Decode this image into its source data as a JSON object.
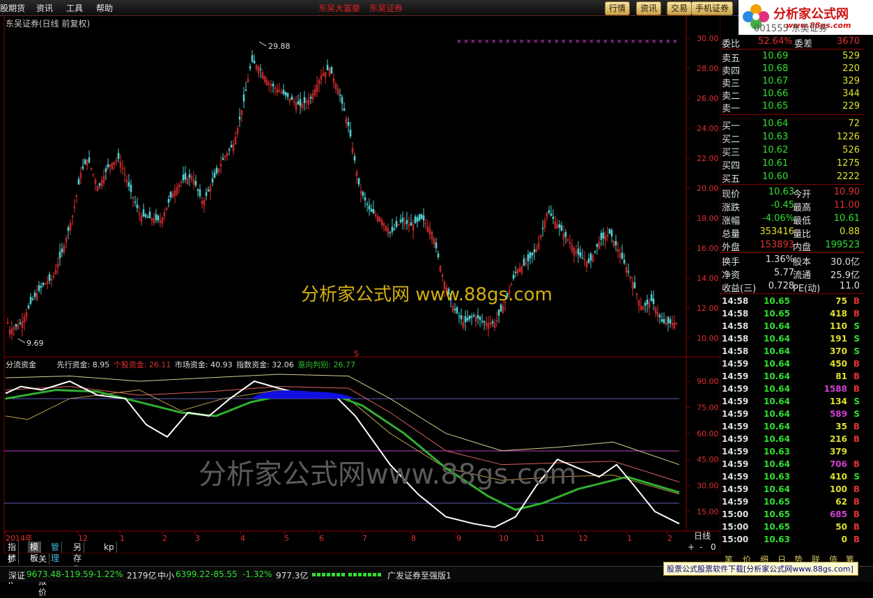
{
  "menu": {
    "items": [
      "股期货",
      "资讯",
      "工具",
      "帮助"
    ],
    "center": [
      "东吴大富豪",
      "东吴证券"
    ]
  },
  "toolbar_buttons": [
    "行情",
    "资讯",
    "交易",
    "手机证券"
  ],
  "logo": {
    "title": "分析家公式网",
    "url": "www.88gs.com"
  },
  "header_ghost": "001555 东吴证券",
  "chart": {
    "title": "东吴证券(日线 前复权)",
    "price_axis": [
      "30.00",
      "28.00",
      "26.00",
      "24.00",
      "22.00",
      "20.00",
      "18.00",
      "16.00",
      "14.00",
      "12.00",
      "10.00"
    ],
    "indicator_axis": [
      "90.00",
      "75.00",
      "60.00",
      "45.00",
      "30.00",
      "15.00"
    ],
    "high_label": "29.88",
    "low_label": "9.69",
    "x_labels": [
      "2014年",
      "12",
      "1",
      "2",
      "3",
      "4",
      "5",
      "6",
      "7",
      "8",
      "9",
      "10",
      "11",
      "12",
      "1",
      "2"
    ],
    "period_label": "日线",
    "marker_s": "S"
  },
  "indicator": {
    "name": "分流资金",
    "values": [
      {
        "label": "先行资金: 8.95",
        "color": "#e0e0e0"
      },
      {
        "label": "个股资金: 26.11",
        "color": "#e03030"
      },
      {
        "label": "市场资金: 40.93",
        "color": "#e0e0e0"
      },
      {
        "label": "指数资金: 32.06",
        "color": "#e0e0e0"
      },
      {
        "label": "意向判别: 26.77",
        "color": "#30c030"
      }
    ]
  },
  "watermarks": {
    "top": "分析家公式网 www.88gs.com",
    "bottom": "分析家公式网www.88gs.com"
  },
  "quote": {
    "weibi": {
      "label": "委比",
      "value": "52.64%",
      "label2": "委差",
      "value2": "3670"
    },
    "asks": [
      {
        "label": "卖五",
        "price": "10.69",
        "vol": "529"
      },
      {
        "label": "卖四",
        "price": "10.68",
        "vol": "220"
      },
      {
        "label": "卖三",
        "price": "10.67",
        "vol": "329"
      },
      {
        "label": "卖二",
        "price": "10.66",
        "vol": "344"
      },
      {
        "label": "卖一",
        "price": "10.65",
        "vol": "229"
      }
    ],
    "bids": [
      {
        "label": "买一",
        "price": "10.64",
        "vol": "72"
      },
      {
        "label": "买二",
        "price": "10.63",
        "vol": "1226"
      },
      {
        "label": "买三",
        "price": "10.62",
        "vol": "526"
      },
      {
        "label": "买四",
        "price": "10.61",
        "vol": "1275"
      },
      {
        "label": "买五",
        "price": "10.60",
        "vol": "2222"
      }
    ],
    "stats": [
      {
        "l1": "现价",
        "v1": "10.63",
        "c1": "#30e030",
        "l2": "今开",
        "v2": "10.90",
        "c2": "#e03030"
      },
      {
        "l1": "涨跌",
        "v1": "-0.45",
        "c1": "#30e030",
        "l2": "最高",
        "v2": "11.00",
        "c2": "#e03030"
      },
      {
        "l1": "涨幅",
        "v1": "-4.06%",
        "c1": "#30e030",
        "l2": "最低",
        "v2": "10.61",
        "c2": "#30e030"
      },
      {
        "l1": "总量",
        "v1": "353416",
        "c1": "#e0e030",
        "l2": "量比",
        "v2": "0.88",
        "c2": "#e0e030"
      },
      {
        "l1": "外盘",
        "v1": "153893",
        "c1": "#e03030",
        "l2": "内盘",
        "v2": "199523",
        "c2": "#30e030"
      }
    ],
    "fund": [
      {
        "l1": "换手",
        "v1": "1.36%",
        "l2": "股本",
        "v2": "30.0亿"
      },
      {
        "l1": "净资",
        "v1": "5.77",
        "l2": "流通",
        "v2": "25.9亿"
      },
      {
        "l1": "收益(三)",
        "v1": "0.728",
        "l2": "PE(动)",
        "v2": "11.0"
      }
    ]
  },
  "ticks": [
    {
      "t": "14:58",
      "p": "10.65",
      "v": "75",
      "s": "B",
      "pc": "#30e030",
      "vc": "#e0e030"
    },
    {
      "t": "14:58",
      "p": "10.65",
      "v": "418",
      "s": "B",
      "pc": "#30e030",
      "vc": "#e0e030"
    },
    {
      "t": "14:58",
      "p": "10.64",
      "v": "110",
      "s": "S",
      "pc": "#30e030",
      "vc": "#e0e030"
    },
    {
      "t": "14:58",
      "p": "10.64",
      "v": "191",
      "s": "S",
      "pc": "#30e030",
      "vc": "#e0e030"
    },
    {
      "t": "14:58",
      "p": "10.64",
      "v": "370",
      "s": "S",
      "pc": "#30e030",
      "vc": "#e0e030"
    },
    {
      "t": "14:59",
      "p": "10.64",
      "v": "450",
      "s": "B",
      "pc": "#30e030",
      "vc": "#e0e030"
    },
    {
      "t": "14:59",
      "p": "10.64",
      "v": "81",
      "s": "B",
      "pc": "#30e030",
      "vc": "#e0e030"
    },
    {
      "t": "14:59",
      "p": "10.64",
      "v": "1588",
      "s": "B",
      "pc": "#30e030",
      "vc": "#d040d0"
    },
    {
      "t": "14:59",
      "p": "10.64",
      "v": "134",
      "s": "S",
      "pc": "#30e030",
      "vc": "#e0e030"
    },
    {
      "t": "14:59",
      "p": "10.64",
      "v": "589",
      "s": "S",
      "pc": "#30e030",
      "vc": "#d040d0"
    },
    {
      "t": "14:59",
      "p": "10.64",
      "v": "35",
      "s": "B",
      "pc": "#30e030",
      "vc": "#e0e030"
    },
    {
      "t": "14:59",
      "p": "10.64",
      "v": "216",
      "s": "B",
      "pc": "#30e030",
      "vc": "#e0e030"
    },
    {
      "t": "14:59",
      "p": "10.63",
      "v": "379",
      "s": "",
      "pc": "#30e030",
      "vc": "#e0e030"
    },
    {
      "t": "14:59",
      "p": "10.64",
      "v": "706",
      "s": "B",
      "pc": "#30e030",
      "vc": "#d040d0"
    },
    {
      "t": "14:59",
      "p": "10.63",
      "v": "410",
      "s": "S",
      "pc": "#30e030",
      "vc": "#e0e030"
    },
    {
      "t": "14:59",
      "p": "10.64",
      "v": "100",
      "s": "B",
      "pc": "#30e030",
      "vc": "#e0e030"
    },
    {
      "t": "14:59",
      "p": "10.65",
      "v": "62",
      "s": "B",
      "pc": "#30e030",
      "vc": "#e0e030"
    },
    {
      "t": "15:00",
      "p": "10.65",
      "v": "685",
      "s": "B",
      "pc": "#30e030",
      "vc": "#d040d0"
    },
    {
      "t": "15:00",
      "p": "10.65",
      "v": "50",
      "s": "B",
      "pc": "#30e030",
      "vc": "#e0e030"
    },
    {
      "t": "15:00",
      "p": "10.63",
      "v": "0",
      "s": "B",
      "pc": "#30e030",
      "vc": "#e0e030"
    }
  ],
  "bottom_tabs": [
    "指标",
    "模板",
    "管理",
    "另存为",
    "kp"
  ],
  "bottom_tabs2": [
    "扩展∧",
    "关联报价"
  ],
  "right_tabs": [
    "笔",
    "价",
    "细",
    "日",
    "势",
    "联",
    "值",
    "筹"
  ],
  "zoom": [
    "+",
    "-",
    "0"
  ],
  "status": {
    "sz_label": "深证",
    "sz_value": "9673.48",
    "sz_change": "-119.59",
    "sz_pct": "-1.22%",
    "sz_amount": "2179亿",
    "zx_label": "中小",
    "zx_value": "6399.22",
    "zx_change": "-85.55",
    "zx_pct": "-1.32%",
    "zx_amount": "977.3亿",
    "broker": "广发证券至强版1"
  },
  "ad": "股票公式股票软件下载[分析家公式网www.88gs.com]",
  "colors": {
    "up": "#e03030",
    "down": "#50d0d0",
    "green": "#30c030",
    "grid": "#8b0000"
  }
}
